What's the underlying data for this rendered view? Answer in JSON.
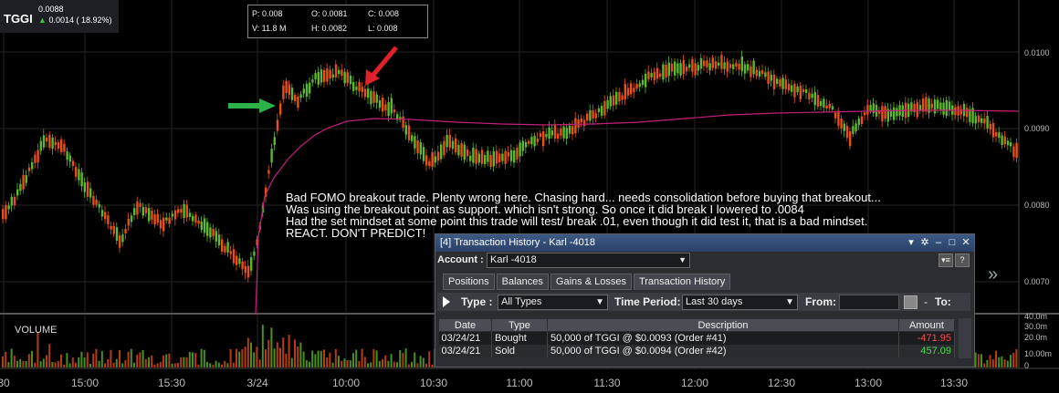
{
  "ticker": {
    "symbol": "TGGI",
    "last": "0.0088",
    "change": "0.0014 ( 18.92%)"
  },
  "ohlc": {
    "p": "P: 0.008",
    "o": "O: 0.0081",
    "c": "C: 0.008",
    "v": "V: 11.8 M",
    "h": "H: 0.0082",
    "l": "L: 0.008"
  },
  "annotation": [
    "Bad FOMO breakout trade. Plenty wrong here. Chasing hard... needs consolidation before buying that breakout...",
    "Was using the breakout point as support. which isn't strong. So once it did break I lowered to .0084",
    "Had the set mindset at some point this trade will test/ break .01, even though it did test it, that is a bad mindset.",
    "REACT. DON'T PREDICT!"
  ],
  "volume_label": "VOLUME",
  "x_axis": [
    "30",
    "15:00",
    "15:30",
    "3/24",
    "10:00",
    "10:30",
    "11:00",
    "11:30",
    "12:00",
    "12:30",
    "13:00",
    "13:30"
  ],
  "y_axis_price": [
    "0.0100",
    "0.0090",
    "0.0080",
    "0.0070"
  ],
  "y_axis_volume": [
    "40.0m",
    "30.0m",
    "20.0m",
    "10.00m",
    "0"
  ],
  "colors": {
    "up": "#5cb82c",
    "down": "#e8501a",
    "ma": "#c0207a",
    "arrow_green": "#2bb34a",
    "arrow_red": "#e0202a"
  },
  "window": {
    "title": "[4] Transaction History - Karl -4018",
    "account_label": "Account :",
    "account_value": "Karl -4018",
    "tabs": [
      "Positions",
      "Balances",
      "Gains & Losses",
      "Transaction History"
    ],
    "active_tab": "Transaction History",
    "type_label": "Type :",
    "type_value": "All Types",
    "period_label": "Time Period:",
    "period_value": "Last 30 days",
    "from_label": "From:",
    "to_label": "To:",
    "columns": [
      "Date",
      "Type",
      "Description",
      "Amount"
    ],
    "rows": [
      {
        "date": "03/24/21",
        "type": "Bought",
        "description": "50,000 of TGGI @ $0.0093 (Order #41)",
        "amount": "-471.95"
      },
      {
        "date": "03/24/21",
        "type": "Sold",
        "description": "50,000 of TGGI @ $0.0094 (Order #42)",
        "amount": "457.09"
      }
    ]
  }
}
